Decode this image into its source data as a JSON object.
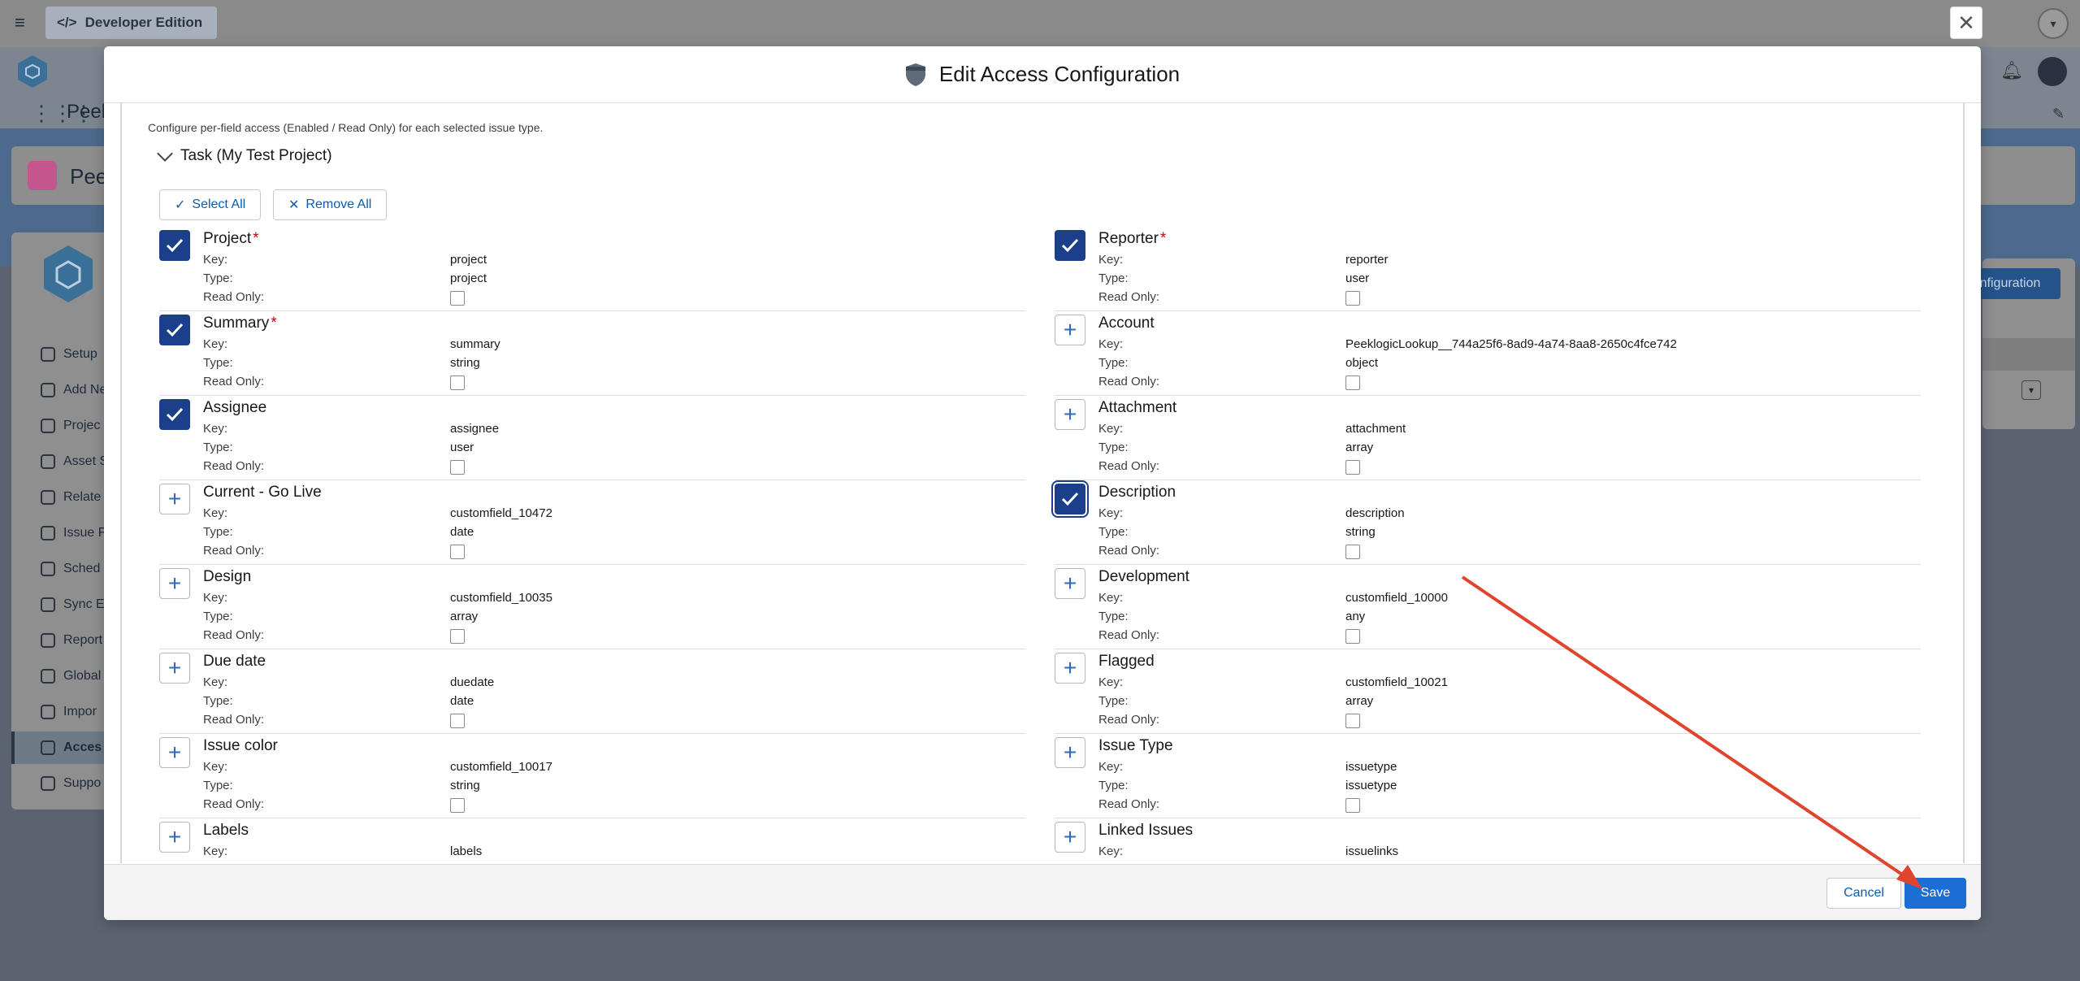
{
  "topbar": {
    "edition_label": "Developer Edition"
  },
  "background": {
    "app_name": "Peek",
    "page_title": "Peel",
    "nav_items": [
      "Setup",
      "Add Ne",
      "Projec",
      "Asset S",
      "Relate",
      "Issue F",
      "Sched",
      "Sync E",
      "Report",
      "Global",
      "Impor",
      "Acces",
      "Suppo"
    ],
    "right_button": "nfiguration"
  },
  "modal": {
    "title": "Edit Access Configuration",
    "description": "Configure per-field access (Enabled / Read Only) for each selected issue type.",
    "section_title": "Task (My Test Project)",
    "select_all": "Select All",
    "remove_all": "Remove All",
    "labels": {
      "key": "Key:",
      "type": "Type:",
      "read_only": "Read Only:"
    },
    "left_fields": [
      {
        "name": "Project",
        "required": "*",
        "key": "project",
        "type": "project",
        "checked": true
      },
      {
        "name": "Summary",
        "required": "*",
        "key": "summary",
        "type": "string",
        "checked": true
      },
      {
        "name": "Assignee",
        "required": "",
        "key": "assignee",
        "type": "user",
        "checked": true
      },
      {
        "name": "Current - Go Live",
        "required": "",
        "key": "customfield_10472",
        "type": "date",
        "checked": false
      },
      {
        "name": "Design",
        "required": "",
        "key": "customfield_10035",
        "type": "array",
        "checked": false
      },
      {
        "name": "Due date",
        "required": "",
        "key": "duedate",
        "type": "date",
        "checked": false
      },
      {
        "name": "Issue color",
        "required": "",
        "key": "customfield_10017",
        "type": "string",
        "checked": false
      },
      {
        "name": "Labels",
        "required": "",
        "key": "labels",
        "type": "",
        "checked": false
      }
    ],
    "right_fields": [
      {
        "name": "Reporter",
        "required": "*",
        "key": "reporter",
        "type": "user",
        "checked": true
      },
      {
        "name": "Account",
        "required": "",
        "key": "PeeklogicLookup__744a25f6-8ad9-4a74-8aa8-2650c4fce742",
        "type": "object",
        "checked": false
      },
      {
        "name": "Attachment",
        "required": "",
        "key": "attachment",
        "type": "array",
        "checked": false
      },
      {
        "name": "Description",
        "required": "",
        "key": "description",
        "type": "string",
        "checked": true
      },
      {
        "name": "Development",
        "required": "",
        "key": "customfield_10000",
        "type": "any",
        "checked": false
      },
      {
        "name": "Flagged",
        "required": "",
        "key": "customfield_10021",
        "type": "array",
        "checked": false
      },
      {
        "name": "Issue Type",
        "required": "",
        "key": "issuetype",
        "type": "issuetype",
        "checked": false
      },
      {
        "name": "Linked Issues",
        "required": "",
        "key": "issuelinks",
        "type": "",
        "checked": false
      }
    ],
    "cancel": "Cancel",
    "save": "Save"
  },
  "colors": {
    "brand_blue": "#1b3f8b",
    "save_blue": "#1b6fd4",
    "annotation_arrow": "#e0442c"
  }
}
